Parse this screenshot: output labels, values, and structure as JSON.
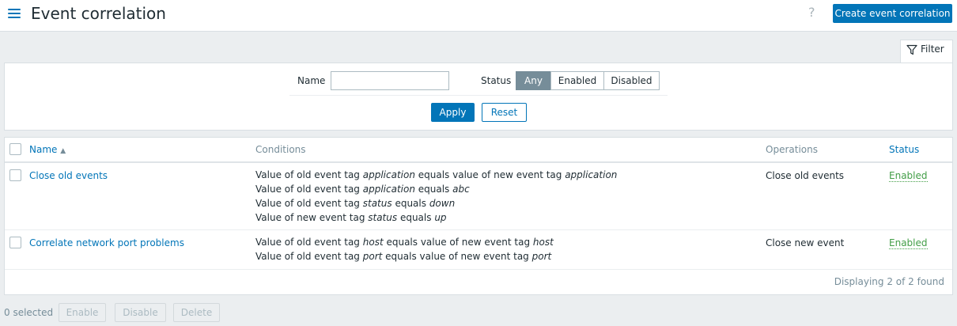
{
  "header": {
    "title": "Event correlation",
    "help": "?",
    "create_label": "Create event correlation"
  },
  "filter": {
    "tab_label": "Filter",
    "name_label": "Name",
    "name_value": "",
    "status_label": "Status",
    "status_options": [
      "Any",
      "Enabled",
      "Disabled"
    ],
    "status_selected": "Any",
    "apply_label": "Apply",
    "reset_label": "Reset"
  },
  "table": {
    "columns": {
      "name": "Name",
      "sort_indicator": "▲",
      "conditions": "Conditions",
      "operations": "Operations",
      "status": "Status"
    },
    "rows": [
      {
        "name": "Close old events",
        "conditions": [
          [
            [
              "Value of old event tag ",
              false
            ],
            [
              "application",
              true
            ],
            [
              " equals value of new event tag ",
              false
            ],
            [
              "application",
              true
            ]
          ],
          [
            [
              "Value of old event tag ",
              false
            ],
            [
              "application",
              true
            ],
            [
              " equals ",
              false
            ],
            [
              "abc",
              true
            ]
          ],
          [
            [
              "Value of old event tag ",
              false
            ],
            [
              "status",
              true
            ],
            [
              " equals ",
              false
            ],
            [
              "down",
              true
            ]
          ],
          [
            [
              "Value of new event tag ",
              false
            ],
            [
              "status",
              true
            ],
            [
              " equals ",
              false
            ],
            [
              "up",
              true
            ]
          ]
        ],
        "operations": "Close old events",
        "status": "Enabled"
      },
      {
        "name": "Correlate network port problems",
        "conditions": [
          [
            [
              "Value of old event tag ",
              false
            ],
            [
              "host",
              true
            ],
            [
              " equals value of new event tag ",
              false
            ],
            [
              "host",
              true
            ]
          ],
          [
            [
              "Value of old event tag ",
              false
            ],
            [
              "port",
              true
            ],
            [
              " equals value of new event tag ",
              false
            ],
            [
              "port",
              true
            ]
          ]
        ],
        "operations": "Close new event",
        "status": "Enabled"
      }
    ],
    "footer": "Displaying 2 of 2 found"
  },
  "mass_actions": {
    "selected": "0 selected",
    "enable_label": "Enable",
    "disable_label": "Disable",
    "delete_label": "Delete"
  },
  "colors": {
    "accent": "#0275b8",
    "enabled_status": "#429e47",
    "segment_active": "#768d99"
  }
}
